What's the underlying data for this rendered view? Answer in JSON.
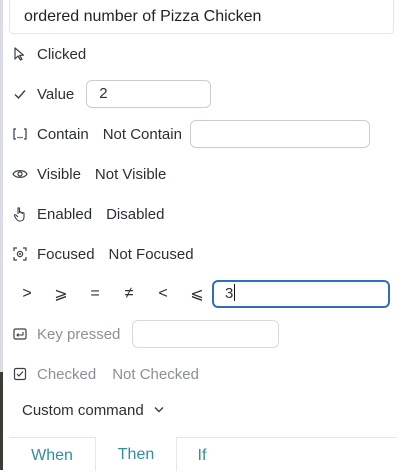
{
  "step_title": "ordered number of Pizza Chicken",
  "rows": {
    "clicked": {
      "icon": "cursor-icon",
      "label": "Clicked"
    },
    "value": {
      "icon": "check-icon",
      "label": "Value",
      "field_value": "2"
    },
    "contain": {
      "icon": "brackets-icon",
      "label": "Contain",
      "alt": "Not Contain",
      "field_value": ""
    },
    "visible": {
      "icon": "eye-icon",
      "label": "Visible",
      "alt": "Not Visible"
    },
    "enabled": {
      "icon": "hand-pointer-icon",
      "label": "Enabled",
      "alt": "Disabled"
    },
    "focused": {
      "icon": "focus-icon",
      "label": "Focused",
      "alt": "Not Focused"
    },
    "compare": {
      "operators": [
        ">",
        "⩾",
        "=",
        "≠",
        "<",
        "⩽"
      ],
      "field_value": "3"
    },
    "key_pressed": {
      "icon": "keyboard-icon",
      "label": "Key pressed",
      "field_value": ""
    },
    "checked": {
      "icon": "checkbox-icon",
      "label": "Checked",
      "alt": "Not Checked"
    }
  },
  "custom_command": {
    "label": "Custom command"
  },
  "tabs": [
    "When",
    "Then",
    "If"
  ],
  "colors": {
    "accent": "#2f8f9f",
    "focus_border": "#2f6fb8"
  }
}
